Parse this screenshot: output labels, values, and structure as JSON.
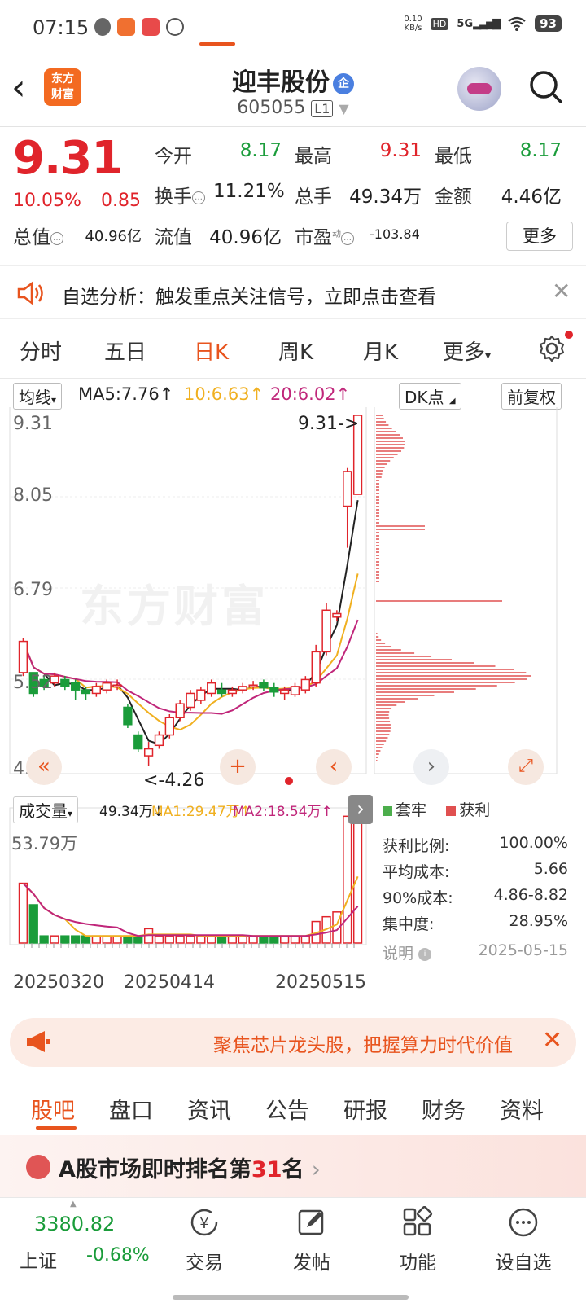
{
  "status_bar": {
    "time": "07:15",
    "net_speed": "0.10\nKB/s",
    "battery": "93",
    "hd": "HD",
    "signal": "5G"
  },
  "header": {
    "back": "‹",
    "logo_line1": "东方",
    "logo_line2": "财富",
    "stock_name": "迎丰股份",
    "badge": "企",
    "stock_code": "605055",
    "level": "L1"
  },
  "quote": {
    "price": "9.31",
    "change_pct": "10.05%",
    "change": "0.85",
    "open_label": "今开",
    "open": "8.17",
    "high_label": "最高",
    "high": "9.31",
    "low_label": "最低",
    "low": "8.17",
    "turnover_label": "换手",
    "turnover": "11.21%",
    "volume_label": "总手",
    "volume": "49.34万",
    "amount_label": "金额",
    "amount": "4.46亿",
    "mktcap_label": "总值",
    "mktcap": "40.96亿",
    "float_label": "流值",
    "float": "40.96亿",
    "pe_label": "市盈",
    "pe_sup": "动",
    "pe": "-103.84",
    "more": "更多"
  },
  "notice": {
    "text": "自选分析：触发重点关注信号，立即点击查看"
  },
  "kline_tabs": [
    "分时",
    "五日",
    "日K",
    "周K",
    "月K",
    "更多"
  ],
  "chart_header": {
    "ma_select": "均线",
    "ma5": "MA5:7.76",
    "ma10": "10:6.63",
    "ma20": "20:6.02",
    "dk_btn": "DK点",
    "adjust_btn": "前复权"
  },
  "price_axis": {
    "top": "9.31",
    "mid1": "8.05",
    "mid2": "6.79",
    "mid3": "5.52",
    "bottom": "4.26",
    "max_marker": "9.31->",
    "min_marker": "<-4.26"
  },
  "volume_header": {
    "select": "成交量",
    "vol": "49.34万",
    "ma1": "MA1:29.47万",
    "ma2": "MA2:18.54万",
    "axis_top": "53.79万"
  },
  "dates": [
    "20250320",
    "20250414",
    "20250515"
  ],
  "chip": {
    "legend_trapped": "套牢",
    "legend_profit": "获利",
    "rows": [
      {
        "label": "获利比例:",
        "value": "100.00%"
      },
      {
        "label": "平均成本:",
        "value": "5.66"
      },
      {
        "label": "90%成本:",
        "value": "4.86-8.82"
      },
      {
        "label": "集中度:",
        "value": "28.95%"
      }
    ],
    "note_label": "说明",
    "date": "2025-05-15"
  },
  "watermark": "东方财富",
  "banner": {
    "text": "聚焦芯片龙头股，把握算力时代价值"
  },
  "bottom_tabs": [
    "股吧",
    "盘口",
    "资讯",
    "公告",
    "研报",
    "财务",
    "资料"
  ],
  "rank": {
    "prefix": "A股市场即时排名第",
    "num": "31",
    "suffix": "名"
  },
  "bottom_nav": {
    "index_value": "3380.82",
    "index_name": "上证",
    "index_change": "-0.68%",
    "items": [
      "交易",
      "发帖",
      "功能",
      "设自选"
    ]
  },
  "colors": {
    "up": "#e0242b",
    "down": "#1a9c3a",
    "accent": "#e8541e",
    "ma5": "#222222",
    "ma10": "#f0b020",
    "ma20": "#c0267a"
  },
  "chart_data": {
    "type": "candlestick",
    "ylim": [
      4.26,
      9.31
    ],
    "candles": [
      [
        5.6,
        6.05,
        5.55,
        6.1,
        0
      ],
      [
        5.6,
        5.3,
        5.25,
        5.6,
        1
      ],
      [
        5.5,
        5.4,
        5.35,
        5.55,
        1
      ],
      [
        5.45,
        5.55,
        5.4,
        5.6,
        0
      ],
      [
        5.5,
        5.4,
        5.35,
        5.55,
        1
      ],
      [
        5.45,
        5.35,
        5.2,
        5.5,
        1
      ],
      [
        5.35,
        5.3,
        5.2,
        5.4,
        1
      ],
      [
        5.3,
        5.4,
        5.25,
        5.45,
        0
      ],
      [
        5.35,
        5.45,
        5.3,
        5.5,
        0
      ],
      [
        5.4,
        5.42,
        5.35,
        5.5,
        0
      ],
      [
        5.1,
        4.85,
        4.8,
        5.15,
        1
      ],
      [
        4.7,
        4.5,
        4.45,
        4.75,
        1
      ],
      [
        4.4,
        4.5,
        4.26,
        4.6,
        0
      ],
      [
        4.55,
        4.7,
        4.5,
        4.75,
        0
      ],
      [
        4.7,
        4.95,
        4.65,
        5.0,
        0
      ],
      [
        4.95,
        5.15,
        4.9,
        5.2,
        0
      ],
      [
        5.1,
        5.3,
        5.05,
        5.35,
        0
      ],
      [
        5.2,
        5.35,
        5.15,
        5.4,
        0
      ],
      [
        5.3,
        5.45,
        5.25,
        5.5,
        0
      ],
      [
        5.35,
        5.3,
        5.25,
        5.45,
        1
      ],
      [
        5.3,
        5.35,
        5.25,
        5.4,
        0
      ],
      [
        5.35,
        5.4,
        5.3,
        5.45,
        0
      ],
      [
        5.4,
        5.42,
        5.35,
        5.48,
        0
      ],
      [
        5.45,
        5.38,
        5.33,
        5.5,
        1
      ],
      [
        5.38,
        5.32,
        5.25,
        5.45,
        1
      ],
      [
        5.3,
        5.35,
        5.2,
        5.4,
        0
      ],
      [
        5.28,
        5.4,
        5.25,
        5.45,
        0
      ],
      [
        5.35,
        5.5,
        5.3,
        5.55,
        0
      ],
      [
        5.45,
        5.9,
        5.4,
        6.0,
        0
      ],
      [
        5.9,
        6.5,
        5.85,
        6.6,
        0
      ],
      [
        6.4,
        6.45,
        6.35,
        6.5,
        0
      ],
      [
        8.0,
        8.5,
        7.4,
        8.55,
        0
      ],
      [
        8.17,
        9.31,
        8.17,
        9.31,
        0
      ]
    ],
    "volume_ylim": [
      0,
      53.79
    ]
  }
}
